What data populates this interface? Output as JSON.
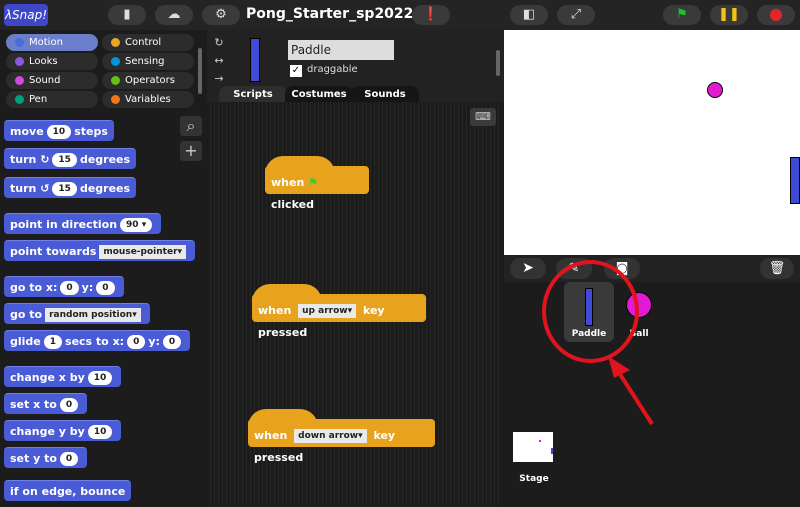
{
  "top": {
    "logo": "λSnap!",
    "project_title": "Pong_Starter_sp2022"
  },
  "categories": [
    {
      "label": "Motion",
      "color": "#4a6cd4",
      "selected": true
    },
    {
      "label": "Control",
      "color": "#e6a822"
    },
    {
      "label": "Looks",
      "color": "#8f56e3"
    },
    {
      "label": "Sensing",
      "color": "#0494dc"
    },
    {
      "label": "Sound",
      "color": "#cf4ad9"
    },
    {
      "label": "Operators",
      "color": "#62c213"
    },
    {
      "label": "Pen",
      "color": "#00a178"
    },
    {
      "label": "Variables",
      "color": "#f3761d"
    }
  ],
  "sprite": {
    "name": "Paddle",
    "draggable_label": "draggable"
  },
  "tabs": {
    "scripts": "Scripts",
    "costumes": "Costumes",
    "sounds": "Sounds"
  },
  "blocks": {
    "move": {
      "a": "move",
      "v": "10",
      "b": "steps"
    },
    "turn_cw": {
      "a": "turn",
      "v": "15",
      "b": "degrees"
    },
    "turn_ccw": {
      "a": "turn",
      "v": "15",
      "b": "degrees"
    },
    "point_dir": {
      "a": "point in direction",
      "v": "90"
    },
    "point_towards": {
      "a": "point towards",
      "v": "mouse-pointer"
    },
    "goto_xy": {
      "a": "go to x:",
      "x": "0",
      "b": "y:",
      "y": "0"
    },
    "goto": {
      "a": "go to",
      "v": "random position"
    },
    "glide": {
      "a": "glide",
      "s": "1",
      "b": "secs to x:",
      "x": "0",
      "c": "y:",
      "y": "0"
    },
    "change_x": {
      "a": "change x by",
      "v": "10"
    },
    "set_x": {
      "a": "set x to",
      "v": "0"
    },
    "change_y": {
      "a": "change y by",
      "v": "10"
    },
    "set_y": {
      "a": "set y to",
      "v": "0"
    },
    "bounce": {
      "a": "if on edge, bounce"
    }
  },
  "scripts": [
    {
      "a": "when",
      "b": "clicked"
    },
    {
      "a": "when",
      "key": "up arrow",
      "b": "key pressed"
    },
    {
      "a": "when",
      "key": "down arrow",
      "b": "key pressed"
    }
  ],
  "corral": {
    "paddle": "Paddle",
    "ball": "Ball",
    "stage": "Stage"
  }
}
